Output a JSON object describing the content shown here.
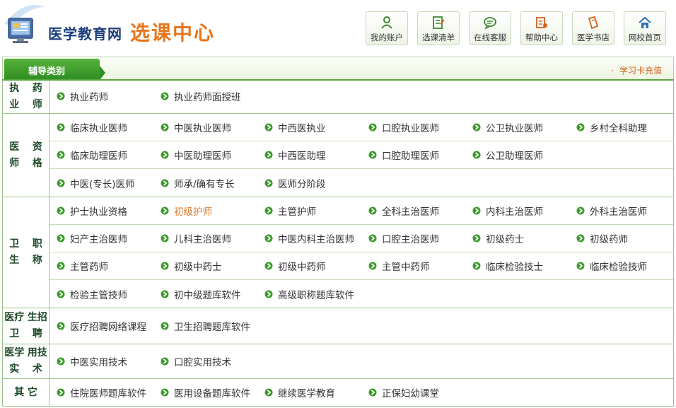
{
  "header": {
    "site_name": "医学教育网",
    "site_sub": "选课中心",
    "logo_icon": "computer-logo-icon"
  },
  "nav": [
    {
      "label": "我的账户",
      "icon": "user-icon"
    },
    {
      "label": "选课清单",
      "icon": "list-icon"
    },
    {
      "label": "在线客服",
      "icon": "chat-icon"
    },
    {
      "label": "帮助中心",
      "icon": "help-icon"
    },
    {
      "label": "医学书店",
      "icon": "book-icon"
    },
    {
      "label": "网校首页",
      "icon": "home-icon"
    }
  ],
  "tabbar": {
    "tab_label": "辅导类别",
    "recharge_label": "学习卡充值",
    "recharge_dot": "·"
  },
  "colors": {
    "accent_green": "#2e8e22",
    "active_orange": "#e07a2e",
    "link_orange": "#d4601a",
    "title_blue": "#1a3d7c"
  },
  "groups": [
    {
      "category": [
        "执 业",
        "药 师"
      ],
      "rows": [
        [
          "执业药师",
          "执业药师面授班"
        ]
      ]
    },
    {
      "category": [
        "医 师",
        "资 格"
      ],
      "rows": [
        [
          "临床执业医师",
          "中医执业医师",
          "中西医执业",
          "口腔执业医师",
          "公卫执业医师",
          "乡村全科助理"
        ],
        [
          "临床助理医师",
          "中医助理医师",
          "中西医助理",
          "口腔助理医师",
          "公卫助理医师"
        ],
        [
          "中医(专长)医师",
          "师承/确有专长",
          "医师分阶段"
        ]
      ]
    },
    {
      "category": [
        "卫 生",
        "职 称"
      ],
      "rows": [
        [
          "护士执业资格",
          "初级护师",
          "主管护师",
          "全科主治医师",
          "内科主治医师",
          "外科主治医师"
        ],
        [
          "妇产主治医师",
          "儿科主治医师",
          "中医内科主治医师",
          "口腔主治医师",
          "初级药士",
          "初级药师"
        ],
        [
          "主管药师",
          "初级中药士",
          "初级中药师",
          "主管中药师",
          "临床检验技士",
          "临床检验技师"
        ],
        [
          "检验主管技师",
          "初中级题库软件",
          "高级职称题库软件"
        ]
      ]
    },
    {
      "category": [
        "医疗卫",
        "生招聘"
      ],
      "rows": [
        [
          "医疗招聘网络课程",
          "卫生招聘题库软件"
        ]
      ]
    },
    {
      "category": [
        "医学实",
        "用技术"
      ],
      "rows": [
        [
          "中医实用技术",
          "口腔实用技术"
        ]
      ]
    },
    {
      "category": [
        "其 它"
      ],
      "rows": [
        [
          "住院医师题库软件",
          "医用设备题库软件",
          "继续医学教育",
          "正保妇幼课堂"
        ]
      ]
    }
  ],
  "active_item": "初级护师"
}
